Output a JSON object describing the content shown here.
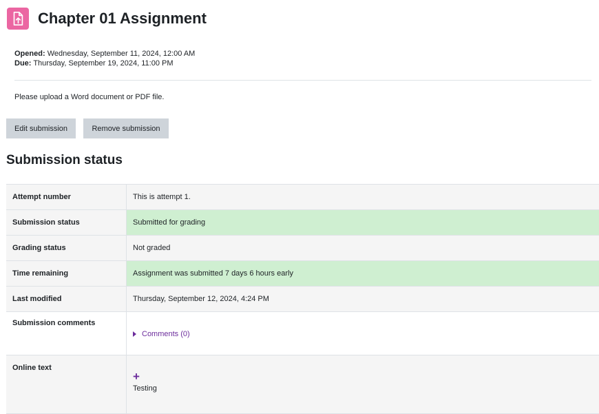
{
  "header": {
    "title": "Chapter 01 Assignment",
    "icon": "assignment-upload-icon",
    "icon_color": "#eb66a2"
  },
  "dates": {
    "opened_label": "Opened:",
    "opened_value": "Wednesday, September 11, 2024, 12:00 AM",
    "due_label": "Due:",
    "due_value": "Thursday, September 19, 2024, 11:00 PM"
  },
  "intro": "Please upload a Word document or PDF file.",
  "actions": {
    "edit_label": "Edit submission",
    "remove_label": "Remove submission"
  },
  "submission_status": {
    "heading": "Submission status",
    "rows": [
      {
        "label": "Attempt number",
        "value": "This is attempt 1."
      },
      {
        "label": "Submission status",
        "value": "Submitted for grading"
      },
      {
        "label": "Grading status",
        "value": "Not graded"
      },
      {
        "label": "Time remaining",
        "value": "Assignment was submitted 7 days 6 hours early"
      },
      {
        "label": "Last modified",
        "value": "Thursday, September 12, 2024, 4:24 PM"
      },
      {
        "label": "Submission comments",
        "value": "Comments (0)"
      },
      {
        "label": "Online text",
        "value": "Testing"
      }
    ]
  },
  "colors": {
    "success_bg": "#cfefd1",
    "link": "#6c2d9c",
    "button_bg": "#ced4da"
  }
}
